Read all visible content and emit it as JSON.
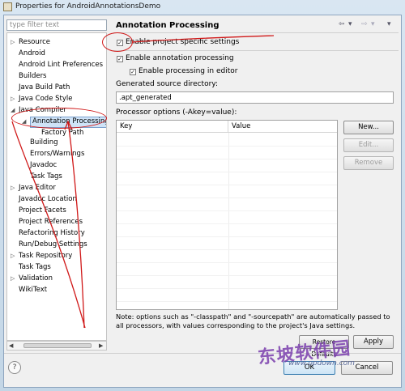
{
  "window": {
    "title": "Properties for AndroidAnnotationsDemo"
  },
  "sidebar": {
    "filter_placeholder": "type filter text",
    "items": [
      {
        "label": "Resource",
        "twisty": "▷"
      },
      {
        "label": "Android",
        "twisty": ""
      },
      {
        "label": "Android Lint Preferences",
        "twisty": ""
      },
      {
        "label": "Builders",
        "twisty": ""
      },
      {
        "label": "Java Build Path",
        "twisty": ""
      },
      {
        "label": "Java Code Style",
        "twisty": "▷"
      },
      {
        "label": "Java Compiler",
        "twisty": "◢"
      },
      {
        "label": "Annotation Processing",
        "twisty": "◢"
      },
      {
        "label": "Factory Path",
        "twisty": ""
      },
      {
        "label": "Building",
        "twisty": ""
      },
      {
        "label": "Errors/Warnings",
        "twisty": ""
      },
      {
        "label": "Javadoc",
        "twisty": ""
      },
      {
        "label": "Task Tags",
        "twisty": ""
      },
      {
        "label": "Java Editor",
        "twisty": "▷"
      },
      {
        "label": "Javadoc Location",
        "twisty": ""
      },
      {
        "label": "Project Facets",
        "twisty": ""
      },
      {
        "label": "Project References",
        "twisty": ""
      },
      {
        "label": "Refactoring History",
        "twisty": ""
      },
      {
        "label": "Run/Debug Settings",
        "twisty": ""
      },
      {
        "label": "Task Repository",
        "twisty": "▷"
      },
      {
        "label": "Task Tags",
        "twisty": ""
      },
      {
        "label": "Validation",
        "twisty": "▷"
      },
      {
        "label": "WikiText",
        "twisty": ""
      }
    ]
  },
  "main": {
    "title": "Annotation Processing",
    "nav": {
      "back": "⇦",
      "dropdown": "▾",
      "forward": "⇨",
      "menu": "▾"
    },
    "enable_project_specific": {
      "label": "Enable project specific settings",
      "checked": true
    },
    "enable_annotation_processing": {
      "label": "Enable annotation processing",
      "checked": true
    },
    "enable_processing_in_editor": {
      "label": "Enable processing in editor",
      "checked": true
    },
    "generated_dir_label": "Generated source directory:",
    "generated_dir_value": ".apt_generated",
    "processor_options_label": "Processor options (-Akey=value):",
    "table_headers": [
      "Key",
      "Value"
    ],
    "buttons": {
      "new": "New...",
      "edit": "Edit...",
      "remove": "Remove"
    },
    "note": "Note: options such as \"-classpath\" and \"-sourcepath\" are automatically passed to all processors, with values corresponding to the project's Java settings."
  },
  "footer": {
    "restore_defaults": "Restore Defaults",
    "apply": "Apply",
    "ok": "OK",
    "cancel": "Cancel",
    "help_glyph": "?"
  },
  "watermark": {
    "logo": "东坡软件园",
    "url": "www.opdown.com"
  },
  "colors": {
    "annotation_red": "#d01818",
    "selection": "#cfe3f7"
  }
}
